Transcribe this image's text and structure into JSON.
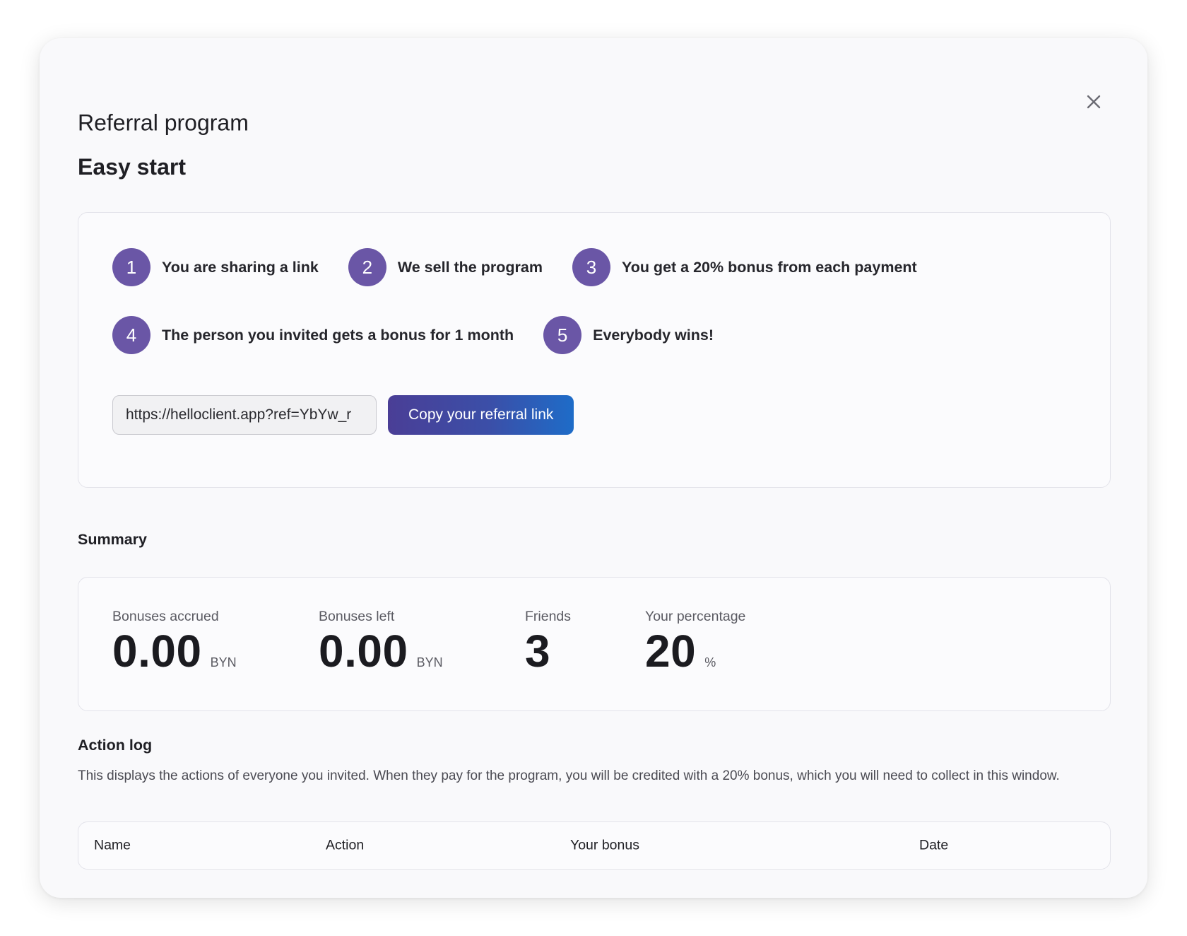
{
  "modal": {
    "title": "Referral program",
    "close_icon": "close-icon"
  },
  "easy_start": {
    "title": "Easy start",
    "steps": [
      {
        "number": "1",
        "text": "You are sharing a link"
      },
      {
        "number": "2",
        "text": "We sell the program"
      },
      {
        "number": "3",
        "text": "You get a 20% bonus from each payment"
      },
      {
        "number": "4",
        "text": "The person you invited gets a bonus for 1 month"
      },
      {
        "number": "5",
        "text": "Everybody wins!"
      }
    ],
    "referral_link_value": "https://helloclient.app?ref=YbYw_r",
    "copy_button_label": "Copy your referral link"
  },
  "summary": {
    "title": "Summary",
    "stats": [
      {
        "label": "Bonuses accrued",
        "value": "0.00",
        "unit": "BYN"
      },
      {
        "label": "Bonuses left",
        "value": "0.00",
        "unit": "BYN"
      },
      {
        "label": "Friends",
        "value": "3",
        "unit": ""
      },
      {
        "label": "Your percentage",
        "value": "20",
        "unit": "%"
      }
    ]
  },
  "action_log": {
    "title": "Action log",
    "description": "This displays the actions of everyone you invited. When they pay for the program, you will be credited with a 20% bonus, which you will need to collect in this window.",
    "columns": [
      "Name",
      "Action",
      "Your bonus",
      "Date"
    ]
  },
  "colors": {
    "step_badge": "#6a56a6",
    "button_gradient_start": "#4a3e96",
    "button_gradient_end": "#1e6cc8"
  }
}
